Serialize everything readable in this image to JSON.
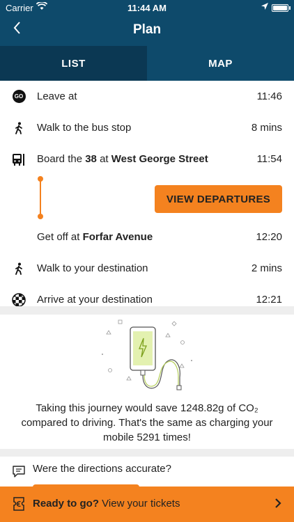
{
  "status_bar": {
    "carrier": "Carrier",
    "time": "11:44 AM"
  },
  "nav": {
    "title": "Plan",
    "back_icon": "chevron-left-icon"
  },
  "tabs": [
    {
      "label": "LIST",
      "active": true
    },
    {
      "label": "MAP",
      "active": false
    }
  ],
  "steps": {
    "leave": {
      "icon_text": "GO",
      "label": "Leave at",
      "value": "11:46"
    },
    "walk_to_stop": {
      "label": "Walk to the bus stop",
      "value": "8 mins"
    },
    "board": {
      "prefix": "Board the",
      "route": "38",
      "at": "at",
      "stop": "West George Street",
      "value": "11:54"
    },
    "view_departures": "VIEW DEPARTURES",
    "get_off": {
      "prefix": "Get off at",
      "stop": "Forfar Avenue",
      "value": "12:20"
    },
    "walk_to_dest": {
      "label": "Walk to your destination",
      "value": "2 mins"
    },
    "arrive": {
      "label": "Arrive at your destination",
      "value": "12:21"
    }
  },
  "co2": {
    "text": "Taking this journey would save 1248.82g of CO₂ compared to driving. That's the same as charging your mobile 5291 times!"
  },
  "feedback": {
    "label": "Were the directions accurate?"
  },
  "bottom_bar": {
    "strong": "Ready to go?",
    "rest": " View your tickets"
  },
  "colors": {
    "header": "#0e4a6b",
    "tab_active": "#0b3853",
    "accent": "#f4821f"
  }
}
